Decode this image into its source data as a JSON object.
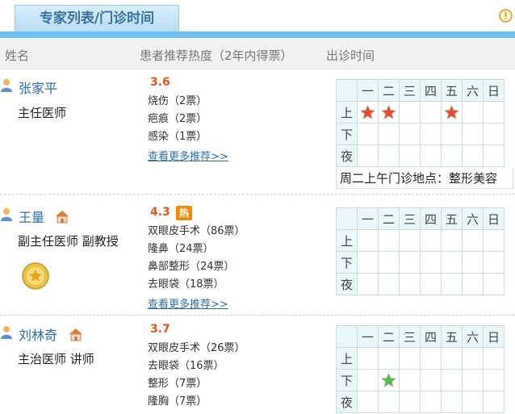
{
  "header": {
    "tab_label": "专家列表/门诊时间",
    "info_icon": "info-icon"
  },
  "columns": {
    "name": "姓名",
    "popularity": "患者推荐热度（2年内得票）",
    "schedule": "出诊时间"
  },
  "schedule_labels": {
    "days": [
      "一",
      "二",
      "三",
      "四",
      "五",
      "六",
      "日"
    ],
    "periods": [
      "上",
      "下",
      "夜"
    ]
  },
  "doctors": [
    {
      "name": "张家平",
      "title": "主任医师",
      "score": "3.6",
      "votes": [
        "烧伤（2票）",
        "疤痕（2票）",
        "感染（1票）"
      ],
      "more": "查看更多推荐>>",
      "clinic": [
        [
          "red",
          "red",
          "",
          "",
          "red",
          "",
          ""
        ],
        [
          "",
          "",
          "",
          "",
          "",
          "",
          ""
        ],
        [
          "",
          "",
          "",
          "",
          "",
          "",
          ""
        ]
      ],
      "note": "周二上午门诊地点：整形美容"
    },
    {
      "name": "王量",
      "title": "副主任医师  副教授",
      "score": "4.3",
      "hot_badge": "热",
      "votes": [
        "双眼皮手术（86票）",
        "隆鼻（24票）",
        "鼻部整形（24票）",
        "去眼袋（18票）"
      ],
      "more": "查看更多推荐>>",
      "clinic": [
        [
          "",
          "",
          "",
          "",
          "",
          "",
          ""
        ],
        [
          "",
          "",
          "",
          "",
          "",
          "",
          ""
        ],
        [
          "",
          "",
          "",
          "",
          "",
          "",
          ""
        ]
      ]
    },
    {
      "name": "刘林奇",
      "title": "主治医师  讲师",
      "score": "3.7",
      "votes": [
        "双眼皮手术（26票）",
        "去眼袋（16票）",
        "整形（7票）",
        "隆胸（7票）"
      ],
      "clinic": [
        [
          "",
          "",
          "",
          "",
          "",
          "",
          ""
        ],
        [
          "",
          "green",
          "",
          "",
          "",
          "",
          ""
        ],
        [
          "",
          "",
          "",
          "",
          "",
          "",
          ""
        ]
      ]
    }
  ],
  "colors": {
    "accent_blue": "#6cc3ef",
    "name_link": "#2c6fa6",
    "score": "#e4571e",
    "hot_badge": "#f08a00",
    "star_red": "#e84c2a",
    "star_green": "#4cc24c"
  }
}
